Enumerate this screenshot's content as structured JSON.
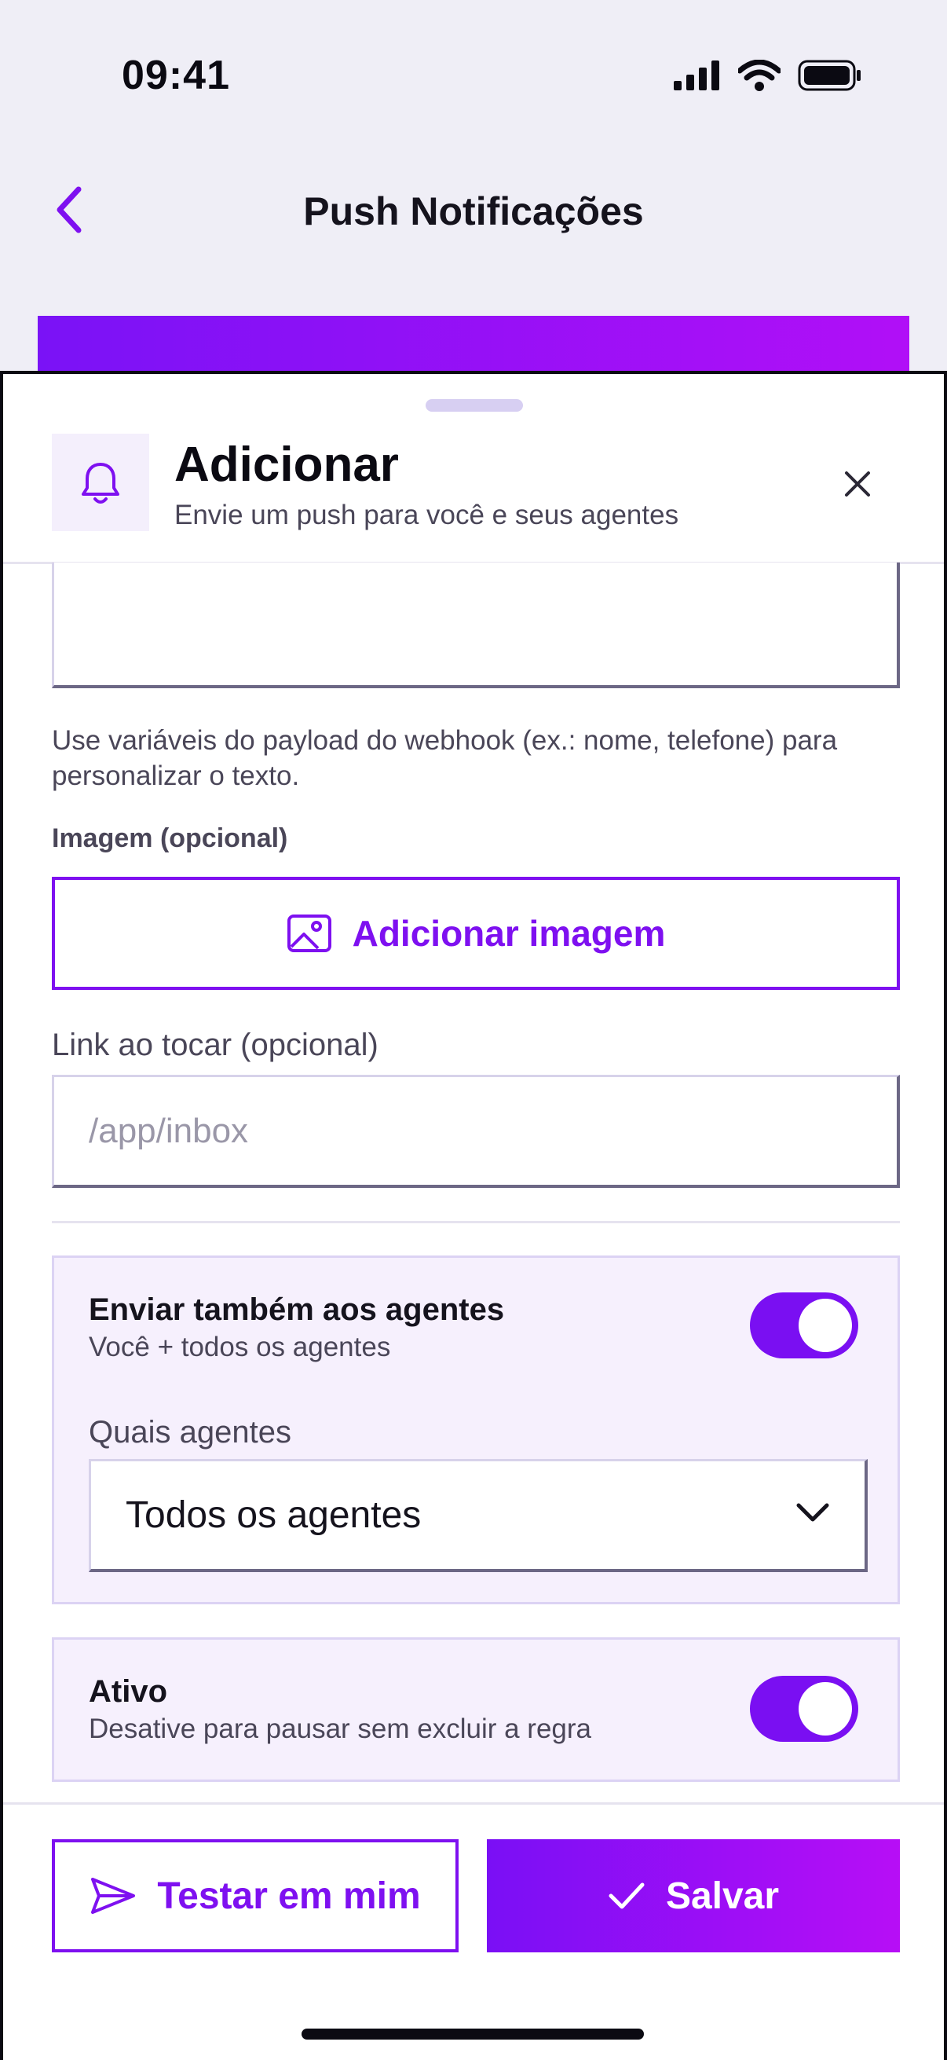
{
  "status_bar": {
    "time": "09:41"
  },
  "nav": {
    "title": "Push Notificações"
  },
  "sheet": {
    "header": {
      "title": "Adicionar",
      "subtitle": "Envie um push para você e seus agentes"
    },
    "helper_text": "Use variáveis do payload do webhook (ex.: nome, telefone) para personalizar o texto.",
    "image": {
      "label": "Imagem (opcional)",
      "button_label": "Adicionar imagem"
    },
    "link": {
      "label": "Link ao tocar (opcional)",
      "placeholder": "/app/inbox"
    },
    "agents_card": {
      "title": "Enviar também aos agentes",
      "subtitle": "Você + todos os agentes",
      "toggle_on": true,
      "select_label": "Quais agentes",
      "select_value": "Todos os agentes"
    },
    "active_card": {
      "title": "Ativo",
      "subtitle": "Desative para pausar sem excluir a regra",
      "toggle_on": true
    },
    "footer": {
      "test_label": "Testar em mim",
      "save_label": "Salvar"
    }
  },
  "colors": {
    "accent": "#7e10f0",
    "gradient_start": "#7a0ff5",
    "gradient_end": "#b70ef6",
    "card_bg": "#f6f0fd"
  },
  "icons": {
    "back": "chevron-left-icon",
    "bell": "bell-icon",
    "close": "close-icon",
    "image": "image-icon",
    "chevron_down": "chevron-down-icon",
    "send": "send-icon",
    "check": "check-icon"
  }
}
